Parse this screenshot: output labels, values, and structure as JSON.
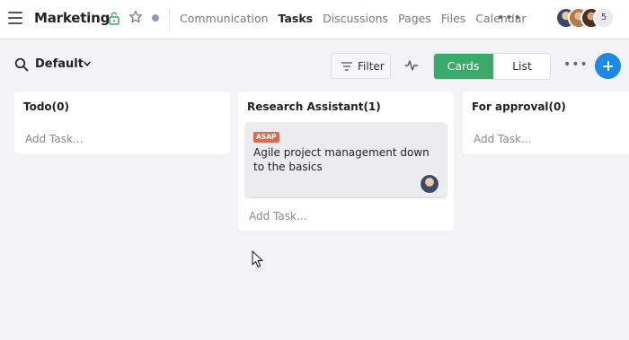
{
  "header": {
    "title": "Marketing",
    "nav": [
      "Communication",
      "Tasks",
      "Discussions",
      "Pages",
      "Files",
      "Calendar"
    ],
    "active_tab": "Tasks",
    "more_label": "•••",
    "member_overflow_count": "5"
  },
  "toolbar": {
    "view_name": "Default",
    "filter_label": "Filter",
    "cards_label": "Cards",
    "list_label": "List",
    "more_label": "•••"
  },
  "columns": [
    {
      "title": "Todo(0)",
      "add_task": "Add Task..."
    },
    {
      "title": "Research Assistant(1)",
      "add_task": "Add Task...",
      "tasks": [
        {
          "tag": "ASAP",
          "title": "Agile project management down to the basics"
        }
      ]
    },
    {
      "title": "For approval(0)",
      "add_task": "Add Task..."
    }
  ],
  "colors": {
    "accent_green": "#3aa96a",
    "accent_blue": "#1e88e5",
    "tag_red": "#d9694f",
    "page_background": "#f3f3f5"
  },
  "icons": [
    "hamburger-menu-icon",
    "lock-icon",
    "star-icon",
    "status-dot-icon",
    "search-icon",
    "chevron-down-icon",
    "filter-icon",
    "activity-pulse-icon",
    "more-dots-icon",
    "plus-icon",
    "cursor-icon"
  ]
}
